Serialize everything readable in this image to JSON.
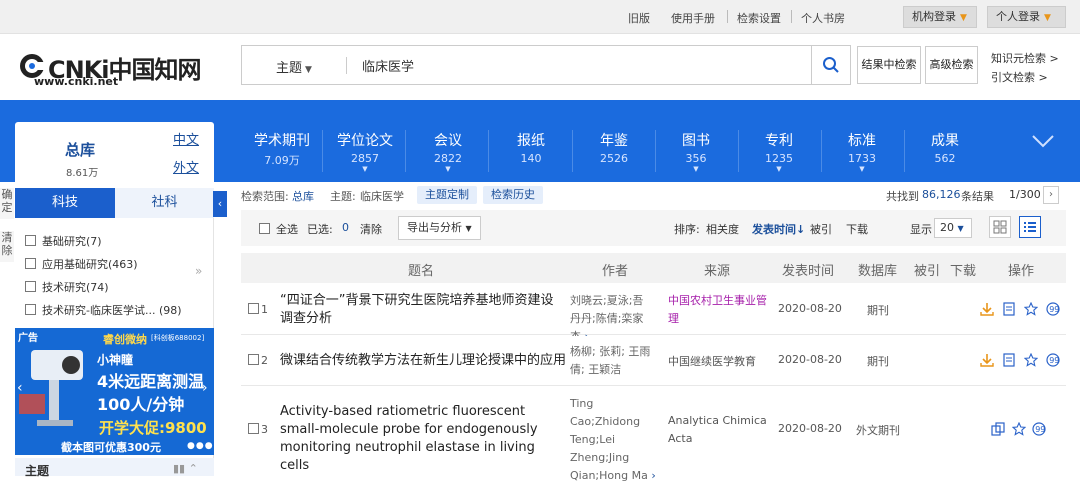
{
  "topbar": {
    "links": [
      "旧版",
      "使用手册",
      "检索设置",
      "个人书房"
    ],
    "institution_login": "机构登录",
    "personal_login": "个人登录"
  },
  "logo": {
    "main": "CNKi中国知网",
    "url": "www.cnki.net"
  },
  "search": {
    "field": "主题",
    "query": "临床医学",
    "btn_result_search": "结果中检索",
    "btn_advanced": "高级检索",
    "knowledge_search": "知识元检索",
    "citation_search": "引文检索"
  },
  "total": {
    "title": "总库",
    "count": "8.61万",
    "lang_cn": "中文",
    "lang_foreign": "外文"
  },
  "databases": [
    {
      "name": "学术期刊",
      "count": "7.09万"
    },
    {
      "name": "学位论文",
      "count": "2857"
    },
    {
      "name": "会议",
      "count": "2822"
    },
    {
      "name": "报纸",
      "count": "140"
    },
    {
      "name": "年鉴",
      "count": "2526"
    },
    {
      "name": "图书",
      "count": "356"
    },
    {
      "name": "专利",
      "count": "1235"
    },
    {
      "name": "标准",
      "count": "1733"
    },
    {
      "name": "成果",
      "count": "562"
    }
  ],
  "sidebar": {
    "tab_sci": "科技",
    "tab_social": "社科",
    "edge_confirm": "确定",
    "edge_clear": "清除",
    "categories": [
      "基础研究(7)",
      "应用基础研究(463)",
      "技术研究(74)",
      "技术研究-临床医学试... (98)"
    ],
    "ad": {
      "tag": "广告",
      "brand": "睿创微纳",
      "brand_sub": "[科创板688002]",
      "line1": "小神瞳",
      "line2": "4米远距离测温",
      "line3": "100人/分钟",
      "line4": "开学大促:9800",
      "line5": "截本图可优惠300元"
    },
    "theme_header": "主题"
  },
  "info": {
    "scope_label": "检索范围:",
    "scope_value": "总库",
    "subject_label": "主题:",
    "subject_value": "临床医学",
    "btn_custom": "主题定制",
    "btn_history": "检索历史",
    "found_prefix": "共找到",
    "found_count": "86,126",
    "found_suffix": "条结果",
    "page": "1/300"
  },
  "toolbar": {
    "select_all": "全选",
    "selected_label": "已选:",
    "selected_count": "0",
    "clear": "清除",
    "export": "导出与分析",
    "sort_label": "排序:",
    "sort_relevance": "相关度",
    "sort_date": "发表时间",
    "sort_cited": "被引",
    "sort_download": "下载",
    "display_label": "显示",
    "display_count": "20"
  },
  "table": {
    "headers": [
      "题名",
      "作者",
      "来源",
      "发表时间",
      "数据库",
      "被引",
      "下载",
      "操作"
    ],
    "rows": [
      {
        "num": "1",
        "title": "“四证合一”背景下研究生医院培养基地师资建设调查分析",
        "authors": "刘晓云;夏泳;吾丹丹;陈倩;栾家杰",
        "source": "中国农村卫生事业管理",
        "date": "2020-08-20",
        "db": "期刊"
      },
      {
        "num": "2",
        "title": "微课结合传统教学方法在新生儿理论授课中的应用",
        "authors": "杨柳; 张莉; 王雨倩; 王颖洁",
        "source": "中国继续医学教育",
        "date": "2020-08-20",
        "db": "期刊"
      },
      {
        "num": "3",
        "title": "Activity-based ratiometric fluorescent small-molecule probe for endogenously monitoring neutrophil elastase in living cells",
        "authors": "Ting Cao;Zhidong Teng;Lei Zheng;Jing Qian;Hong Ma",
        "source": "Analytica Chimica Acta",
        "date": "2020-08-20",
        "db": "外文期刊"
      }
    ]
  }
}
